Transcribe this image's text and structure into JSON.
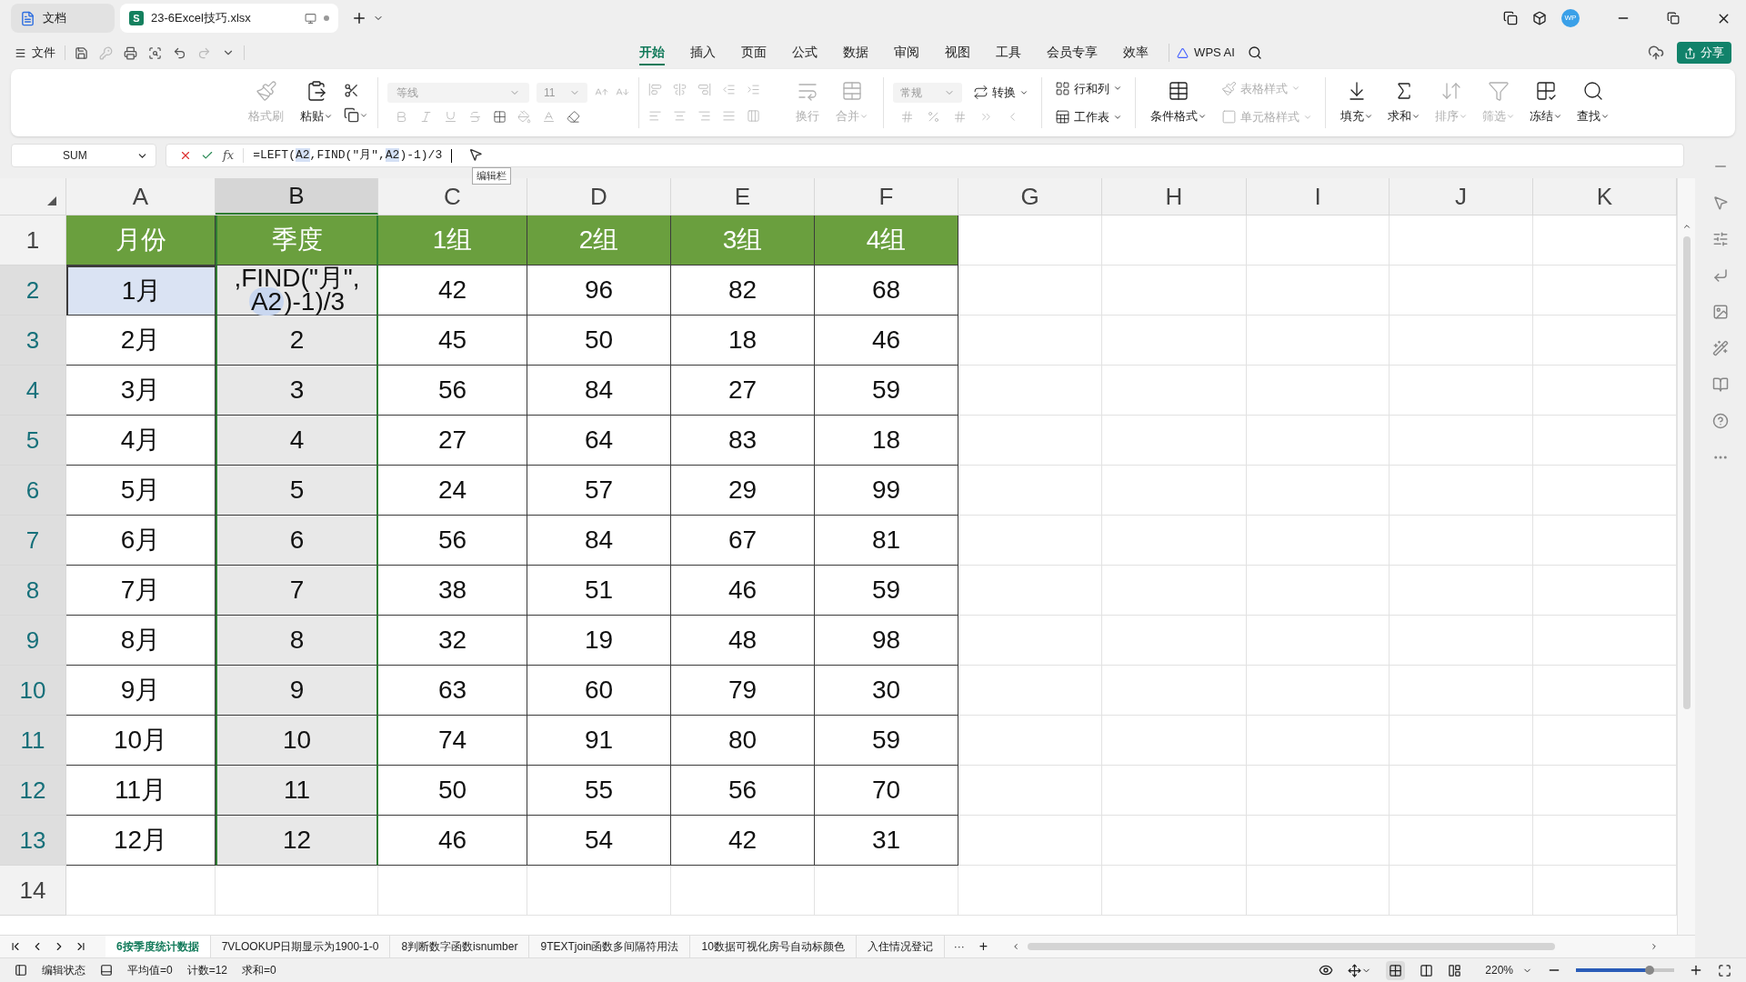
{
  "title_bar": {
    "tabs": [
      {
        "label": "文档",
        "selected": false
      },
      {
        "label": "23-6Excel技巧.xlsx",
        "selected": true,
        "logo": "S"
      }
    ],
    "avatar": "WP"
  },
  "menu": {
    "file": "文件",
    "tabs": [
      {
        "label": "开始",
        "selected": true
      },
      {
        "label": "插入",
        "selected": false
      },
      {
        "label": "页面",
        "selected": false
      },
      {
        "label": "公式",
        "selected": false
      },
      {
        "label": "数据",
        "selected": false
      },
      {
        "label": "审阅",
        "selected": false
      },
      {
        "label": "视图",
        "selected": false
      },
      {
        "label": "工具",
        "selected": false
      },
      {
        "label": "会员专享",
        "selected": false
      },
      {
        "label": "效率",
        "selected": false
      }
    ],
    "ai": "WPS AI",
    "share": "分享"
  },
  "ribbon": {
    "font": "等线",
    "size": "11",
    "number_format": "常规",
    "buttons": [
      {
        "label": "格式刷",
        "disabled": true
      },
      {
        "label": "粘贴",
        "disabled": false
      },
      {
        "label": "换行",
        "disabled": true
      },
      {
        "label": "合并",
        "disabled": true
      },
      {
        "label": "转换",
        "disabled": false
      },
      {
        "label": "行和列",
        "disabled": false
      },
      {
        "label": "工作表",
        "disabled": false
      },
      {
        "label": "条件格式",
        "disabled": false
      },
      {
        "label": "表格样式",
        "disabled": true
      },
      {
        "label": "单元格样式",
        "disabled": true
      },
      {
        "label": "填充",
        "disabled": false
      },
      {
        "label": "求和",
        "disabled": false
      },
      {
        "label": "排序",
        "disabled": true
      },
      {
        "label": "筛选",
        "disabled": true
      },
      {
        "label": "冻结",
        "disabled": false
      },
      {
        "label": "查找",
        "disabled": false
      }
    ]
  },
  "formula_bar": {
    "name_box": "SUM",
    "fx": "fx",
    "formula": [
      {
        "text": "=LEFT(",
        "ref": false
      },
      {
        "text": "A2",
        "ref": true
      },
      {
        "text": ",FIND(\"月\",",
        "ref": false
      },
      {
        "text": "A2",
        "ref": true
      },
      {
        "text": ")-1)/3",
        "ref": false
      }
    ],
    "tooltip": "编辑栏"
  },
  "sheet": {
    "columns": [
      {
        "label": "A",
        "selected": false
      },
      {
        "label": "B",
        "selected": true
      },
      {
        "label": "C",
        "selected": false
      },
      {
        "label": "D",
        "selected": false
      },
      {
        "label": "E",
        "selected": false
      },
      {
        "label": "F",
        "selected": false
      },
      {
        "label": "G",
        "selected": false
      },
      {
        "label": "H",
        "selected": false
      },
      {
        "label": "I",
        "selected": false
      },
      {
        "label": "J",
        "selected": false
      },
      {
        "label": "K",
        "selected": false
      }
    ],
    "rows": [
      {
        "label": "1",
        "selected": false,
        "cells": [
          {
            "kind": "header",
            "text": "月份"
          },
          {
            "kind": "header",
            "text": "季度"
          },
          {
            "kind": "header",
            "text": "1组"
          },
          {
            "kind": "header",
            "text": "2组"
          },
          {
            "kind": "header",
            "text": "3组"
          },
          {
            "kind": "header",
            "text": "4组"
          }
        ]
      },
      {
        "label": "2",
        "selected": true,
        "cells": [
          {
            "kind": "active",
            "text": "1月"
          },
          {
            "kind": "editing",
            "lines": [
              [
                {
                  "text": ",FIND(\"月\",",
                  "ref": false
                }
              ],
              [
                {
                  "text": "A2",
                  "ref": true
                },
                {
                  "text": ")-1)/3",
                  "ref": false
                }
              ]
            ]
          },
          "42",
          "96",
          "82",
          "68"
        ]
      },
      {
        "label": "3",
        "selected": true,
        "cells": [
          "2月",
          "2",
          "45",
          "50",
          "18",
          "46"
        ]
      },
      {
        "label": "4",
        "selected": true,
        "cells": [
          "3月",
          "3",
          "56",
          "84",
          "27",
          "59"
        ]
      },
      {
        "label": "5",
        "selected": true,
        "cells": [
          "4月",
          "4",
          "27",
          "64",
          "83",
          "18"
        ]
      },
      {
        "label": "6",
        "selected": true,
        "cells": [
          "5月",
          "5",
          "24",
          "57",
          "29",
          "99"
        ]
      },
      {
        "label": "7",
        "selected": true,
        "cells": [
          "6月",
          "6",
          "56",
          "84",
          "67",
          "81"
        ]
      },
      {
        "label": "8",
        "selected": true,
        "cells": [
          "7月",
          "7",
          "38",
          "51",
          "46",
          "59"
        ]
      },
      {
        "label": "9",
        "selected": true,
        "cells": [
          "8月",
          "8",
          "32",
          "19",
          "48",
          "98"
        ]
      },
      {
        "label": "10",
        "selected": true,
        "cells": [
          "9月",
          "9",
          "63",
          "60",
          "79",
          "30"
        ]
      },
      {
        "label": "11",
        "selected": true,
        "cells": [
          "10月",
          "10",
          "74",
          "91",
          "80",
          "59"
        ]
      },
      {
        "label": "12",
        "selected": true,
        "cells": [
          "11月",
          "11",
          "50",
          "55",
          "56",
          "70"
        ]
      },
      {
        "label": "13",
        "selected": true,
        "cells": [
          "12月",
          "12",
          "46",
          "54",
          "42",
          "31"
        ]
      },
      {
        "label": "14",
        "selected": false,
        "cells": []
      }
    ]
  },
  "sheet_tabs": {
    "tabs": [
      {
        "label": "6按季度统计数据",
        "selected": true
      },
      {
        "label": "7VLOOKUP日期显示为1900-1-0",
        "selected": false
      },
      {
        "label": "8判断数字函数isnumber",
        "selected": false
      },
      {
        "label": "9TEXTjoin函数多间隔符用法",
        "selected": false
      },
      {
        "label": "10数据可视化房号自动标颜色",
        "selected": false
      },
      {
        "label": "入住情况登记",
        "selected": false
      }
    ],
    "more": "···",
    "add": "+"
  },
  "status_bar": {
    "mode": "编辑状态",
    "average": "平均值=0",
    "count": "计数=12",
    "sum": "求和=0",
    "zoom": "220%",
    "zoom_slider": {
      "level": 0.75
    }
  }
}
